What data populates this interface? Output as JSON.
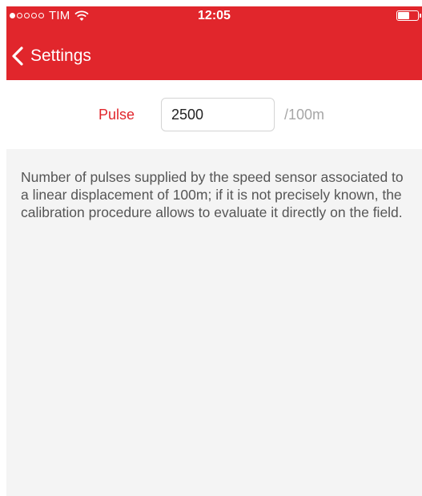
{
  "status_bar": {
    "carrier": "TIM",
    "time": "12:05",
    "signal_bars_filled": 1,
    "signal_bars_total": 5,
    "wifi_icon": "wifi-icon",
    "battery_icon": "battery-icon"
  },
  "navbar": {
    "back_label": "Settings",
    "back_icon": "chevron-left-icon",
    "background_color": "#e1262c"
  },
  "pulse": {
    "label": "Pulse",
    "value": "2500",
    "unit": "/100m"
  },
  "info": {
    "text": "Number of pulses supplied by the speed sensor associated to a linear displacement of 100m; if it is not precisely known, the calibration procedure allows to evaluate it directly on the field."
  },
  "colors": {
    "accent": "#e1262c",
    "panel": "#f4f4f4",
    "unit_text": "#a6a6a6"
  }
}
